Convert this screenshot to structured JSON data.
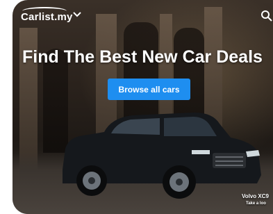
{
  "header": {
    "logo_text": "Carlist.my",
    "menu_icon": "chevron-down-icon",
    "search_icon": "search-icon"
  },
  "hero": {
    "headline": "Find The Best New Car Deals",
    "cta_label": "Browse all cars",
    "caption_title": "Volvo XC9",
    "caption_subtitle": "Take a loo"
  },
  "colors": {
    "cta": "#1e8ef0",
    "text": "#ffffff"
  }
}
